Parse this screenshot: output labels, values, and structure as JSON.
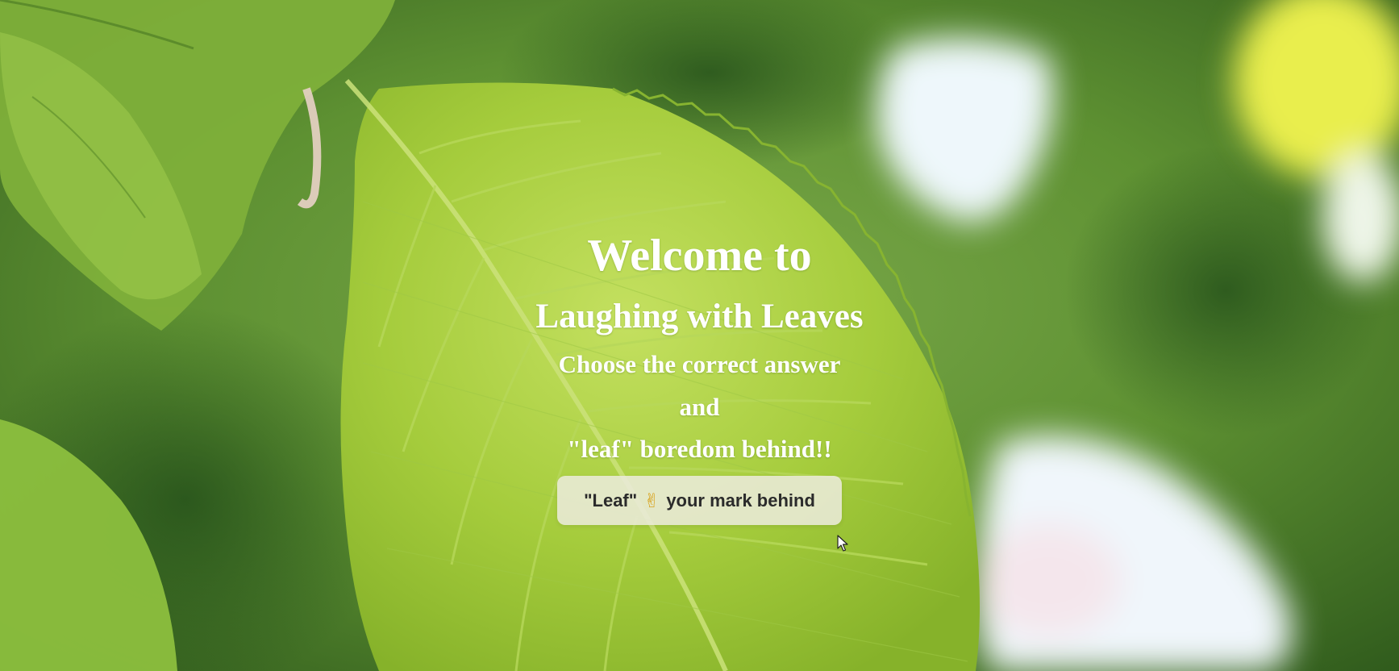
{
  "hero": {
    "title_line1": "Welcome to",
    "title_line2": "Laughing with Leaves",
    "subtitle_line1": "Choose the correct answer",
    "subtitle_line2": "and",
    "subtitle_line3": "\"leaf\" boredom behind!!"
  },
  "cta": {
    "label_before": "\"Leaf\"",
    "emoji": "✌",
    "label_after": "your mark behind"
  },
  "icons": {
    "cta_emoji": "victory-hand-icon",
    "cursor": "mouse-pointer-icon"
  },
  "colors": {
    "background_green": "#3f7a2a",
    "leaf_green": "#a7cf3e",
    "text": "#ffffff",
    "button_bg": "#ebebda",
    "button_text": "#2b2b2b"
  }
}
